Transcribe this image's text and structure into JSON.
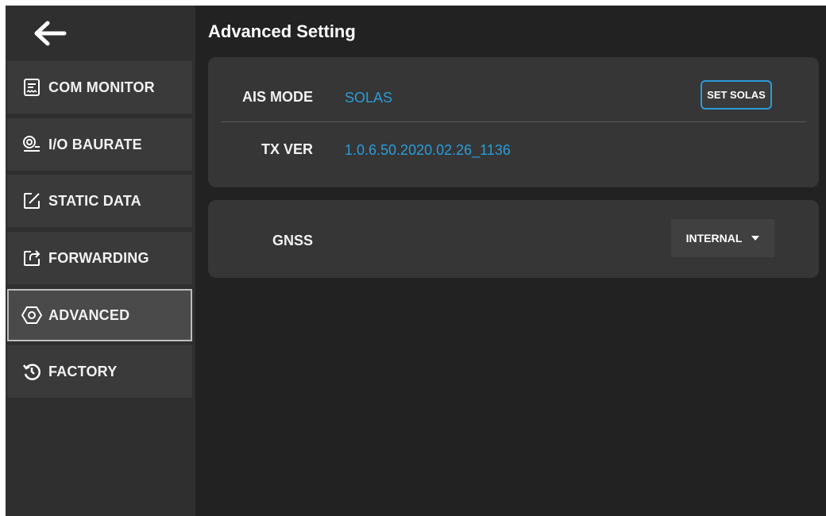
{
  "sidebar": {
    "items": [
      {
        "label": "COM MONITOR",
        "icon": "receipt-icon"
      },
      {
        "label": "I/O BAURATE",
        "icon": "gauge-icon"
      },
      {
        "label": "STATIC DATA",
        "icon": "edit-square-icon"
      },
      {
        "label": "FORWARDING",
        "icon": "forward-share-icon"
      },
      {
        "label": "ADVANCED",
        "icon": "hexagon-settings-icon",
        "active": true
      },
      {
        "label": "FACTORY",
        "icon": "restore-history-icon"
      }
    ]
  },
  "main": {
    "title": "Advanced Setting",
    "ais": {
      "label": "AIS MODE",
      "value": "SOLAS",
      "button": "SET SOLAS"
    },
    "tx": {
      "label": "TX VER",
      "value": "1.0.6.50.2020.02.26_1136"
    },
    "gnss": {
      "label": "GNSS",
      "selected": "INTERNAL"
    }
  },
  "colors": {
    "accent": "#2b9bd8",
    "background": "#222222",
    "sidebar": "#2f2f2f",
    "card": "#363636"
  }
}
